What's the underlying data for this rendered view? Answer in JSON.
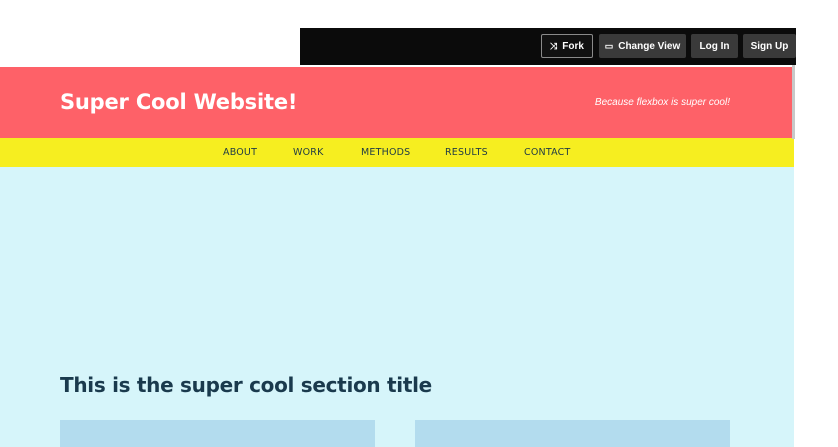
{
  "toolbar": {
    "fork_label": "Fork",
    "change_view_label": "Change View",
    "login_label": "Log In",
    "signup_label": "Sign Up"
  },
  "site": {
    "title": "Super Cool Website!",
    "tagline": "Because flexbox is super cool!"
  },
  "nav": {
    "items": [
      "ABOUT",
      "WORK",
      "METHODS",
      "RESULTS",
      "CONTACT"
    ]
  },
  "main": {
    "section_title": "This is the super cool section title"
  },
  "colors": {
    "header": "#fe6168",
    "nav": "#f6ee20",
    "content": "#d6f5fa",
    "card": "#b3dcee",
    "toolbar": "#0b0b0b"
  }
}
